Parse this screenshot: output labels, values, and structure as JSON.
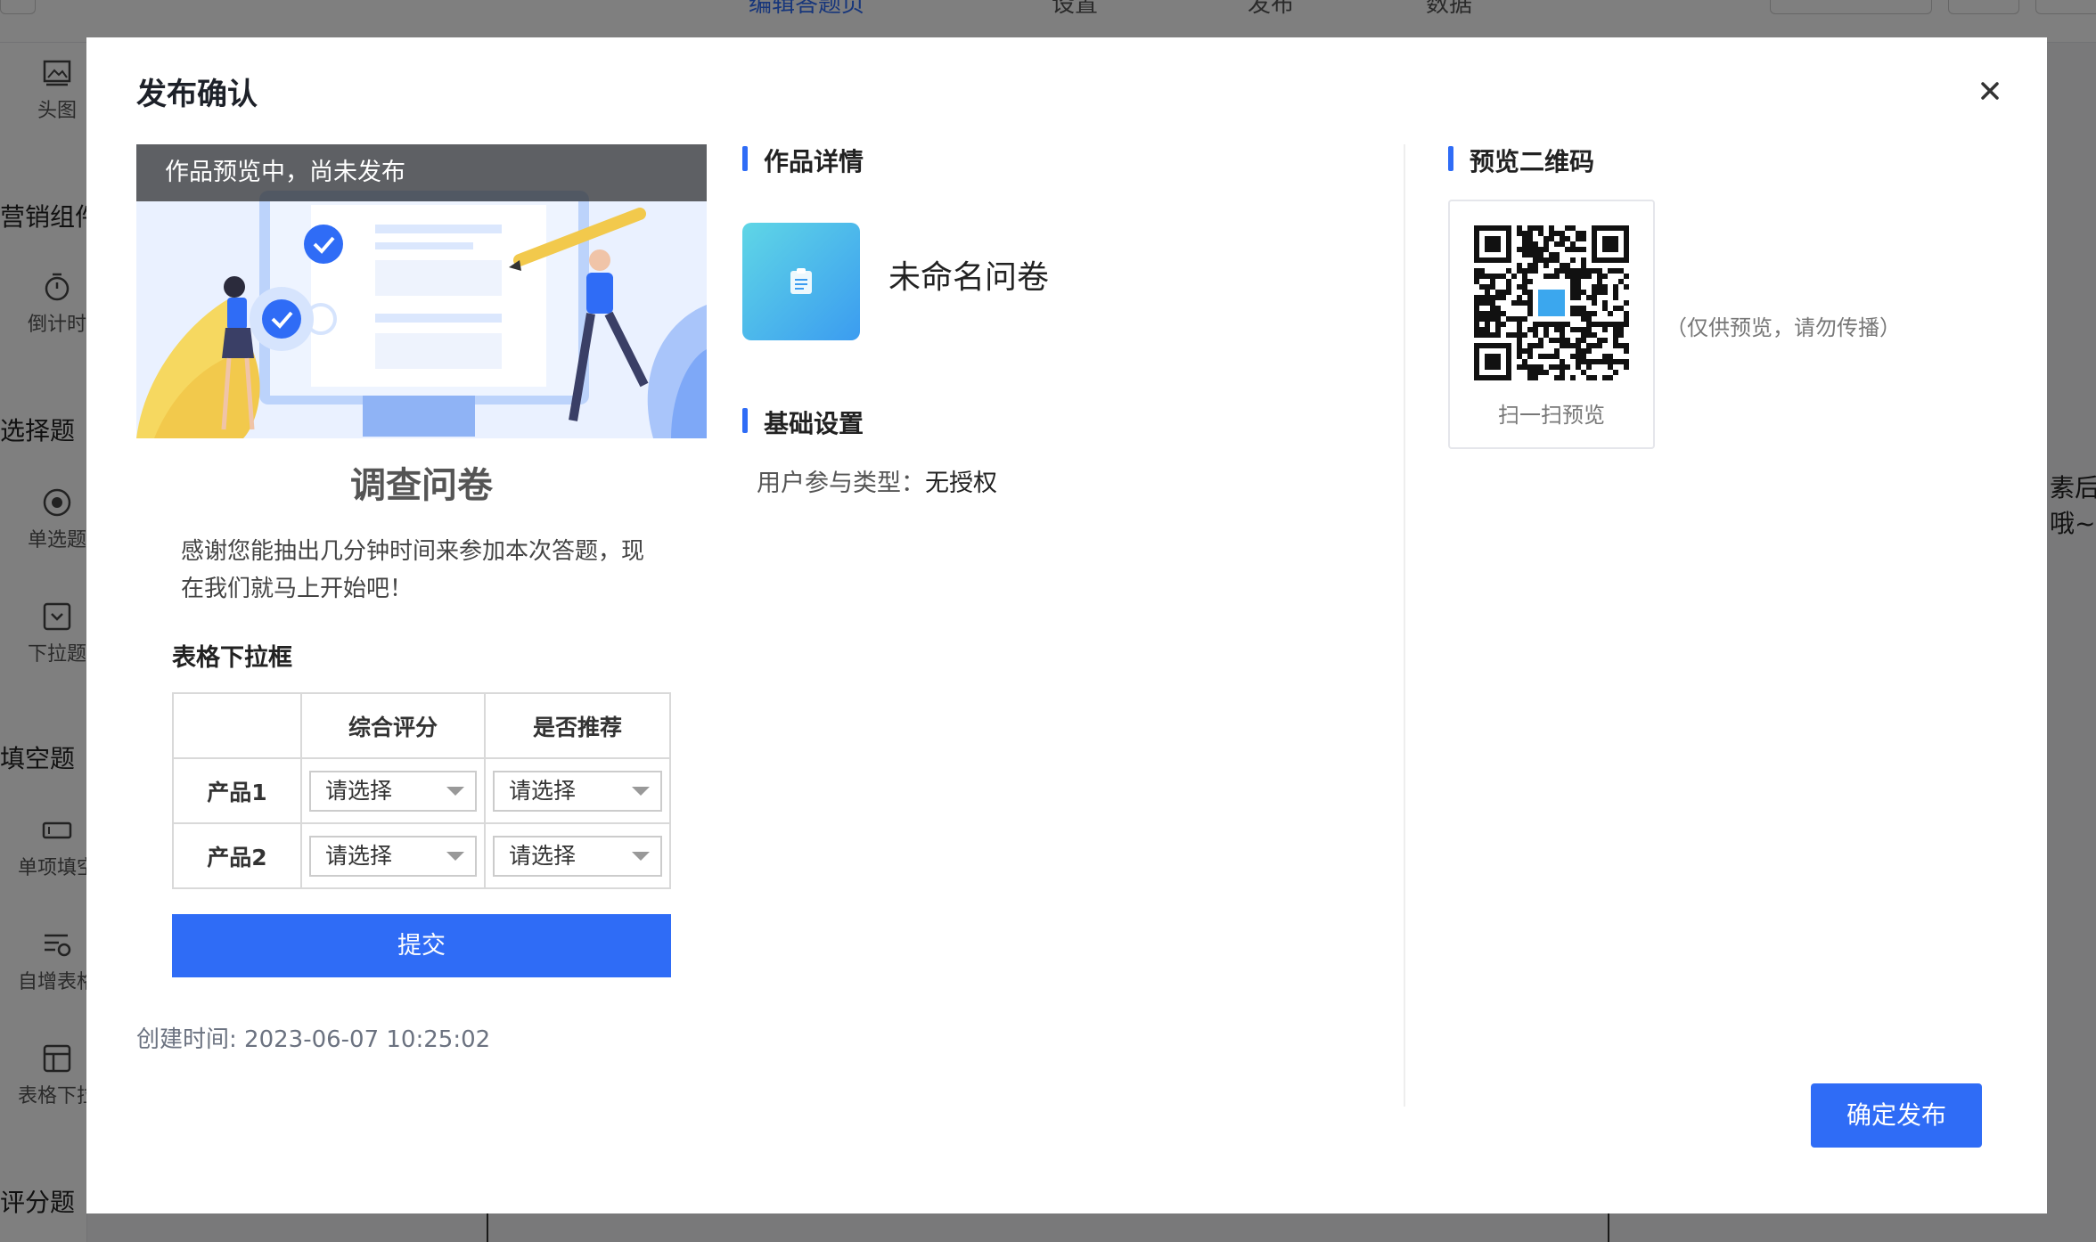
{
  "background": {
    "tabs": [
      "编辑答题页",
      "设置",
      "发布",
      "数据"
    ],
    "sidebar": {
      "sections": [
        "营销组件",
        "选择题",
        "填空题",
        "评分题"
      ],
      "items": [
        "头图",
        "倒计时",
        "单选题",
        "下拉题",
        "单项填空",
        "自增表格",
        "表格下拉"
      ]
    },
    "right_hint_lines": [
      "素后",
      "哦~"
    ]
  },
  "modal": {
    "title": "发布确认",
    "preview": {
      "banner_text": "作品预览中，尚未发布",
      "survey_title": "调查问卷",
      "description": "感谢您能抽出几分钟时间来参加本次答题，现在我们就马上开始吧！",
      "table_title": "表格下拉框",
      "columns": [
        "",
        "综合评分",
        "是否推荐"
      ],
      "rows": [
        {
          "label": "产品1",
          "values": [
            "请选择",
            "请选择"
          ]
        },
        {
          "label": "产品2",
          "values": [
            "请选择",
            "请选择"
          ]
        }
      ],
      "submit_label": "提交",
      "created": "创建时间: 2023-06-07 10:25:02"
    },
    "details": {
      "section_title": "作品详情",
      "work_name": "未命名问卷",
      "settings_title": "基础设置",
      "participation_label": "用户参与类型：",
      "participation_value": "无授权"
    },
    "qr": {
      "section_title": "预览二维码",
      "scan_label": "扫一扫预览",
      "note": "（仅供预览，请勿传播）"
    },
    "confirm_label": "确定发布"
  },
  "colors": {
    "accent": "#2f6cf6",
    "mask": "rgba(0,0,0,0.5)"
  }
}
